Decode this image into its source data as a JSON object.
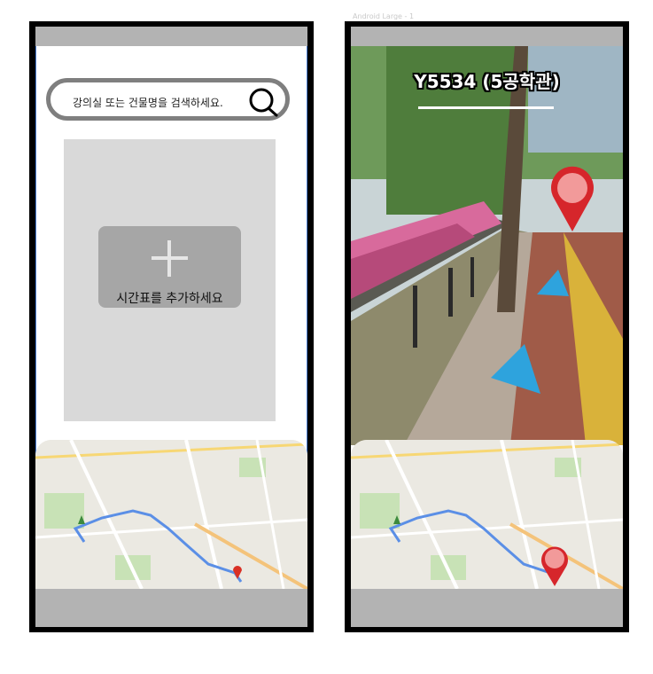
{
  "artboard_label": "Android Large - 1",
  "left_screen": {
    "search": {
      "placeholder": "강의실 또는 건물명을 검색하세요."
    },
    "timetable": {
      "add_label": "시간표를 추가하세요"
    }
  },
  "right_screen": {
    "destination_title": "Y5534 (5공학관)"
  },
  "colors": {
    "frame": "#000000",
    "bar": "#b3b3b3",
    "panel": "#d9d9d9",
    "card": "#a6a6a6",
    "marker": "#e0322f",
    "arrow": "#2ea3dd"
  },
  "icons": [
    "search-icon",
    "plus-icon",
    "map-pin-icon",
    "direction-arrow-icon"
  ]
}
